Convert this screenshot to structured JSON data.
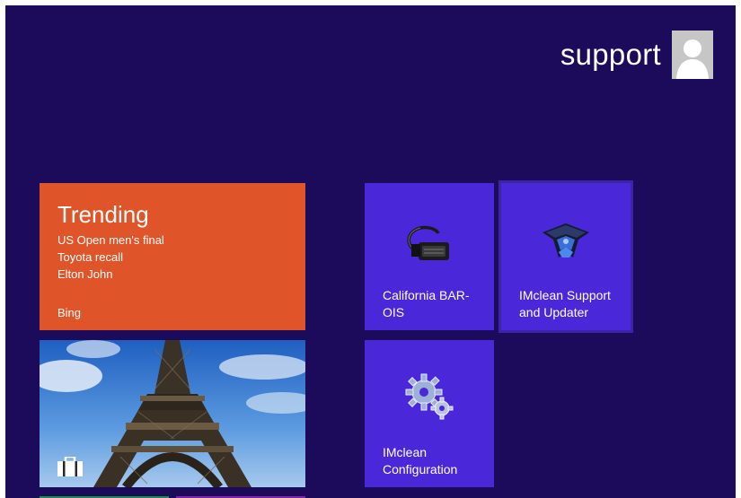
{
  "user": {
    "name": "support"
  },
  "tiles": {
    "trending": {
      "title": "Trending",
      "items": [
        "US Open men's final",
        "Toyota recall",
        "Elton John"
      ],
      "source": "Bing"
    },
    "california_bar": {
      "label_line1": "California BAR-",
      "label_line2": "OIS"
    },
    "imclean_support": {
      "label_line1": "IMclean Support",
      "label_line2": "and Updater"
    },
    "imclean_config": {
      "label_line1": "IMclean",
      "label_line2": "Configuration"
    }
  },
  "colors": {
    "background": "#1c0a5a",
    "trending_tile": "#e0542a",
    "app_tile": "#4a27d8"
  }
}
